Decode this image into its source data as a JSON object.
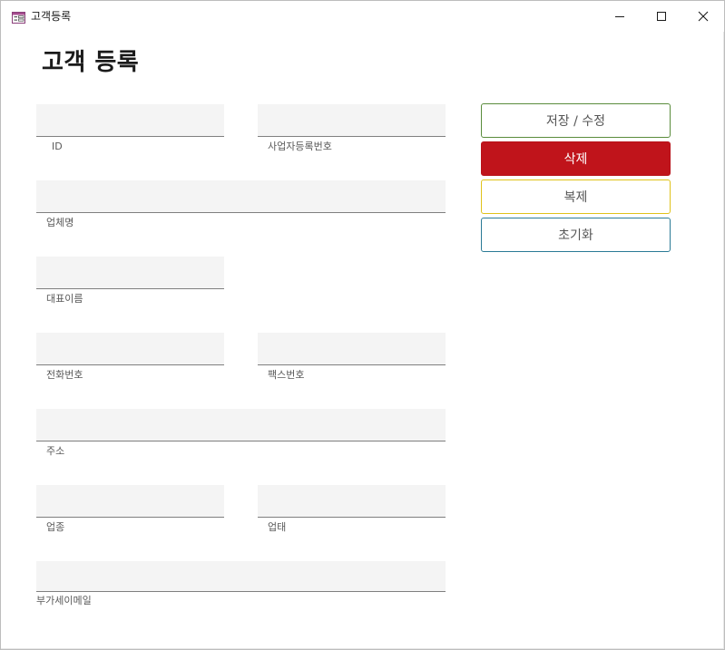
{
  "window": {
    "title": "고객등록",
    "controls": {
      "minimize": "minimize",
      "maximize": "maximize",
      "close": "close"
    }
  },
  "form": {
    "title": "고객 등록",
    "fields": {
      "id": {
        "label": "ID",
        "value": ""
      },
      "business_reg_no": {
        "label": "사업자등록번호",
        "value": ""
      },
      "company_name": {
        "label": "업체명",
        "value": ""
      },
      "representative": {
        "label": "대표이름",
        "value": ""
      },
      "phone": {
        "label": "전화번호",
        "value": ""
      },
      "fax": {
        "label": "팩스번호",
        "value": ""
      },
      "address": {
        "label": "주소",
        "value": ""
      },
      "business_type": {
        "label": "업종",
        "value": ""
      },
      "business_category": {
        "label": "업태",
        "value": ""
      },
      "vat_email": {
        "label": "부가세이메일",
        "value": ""
      }
    }
  },
  "actions": {
    "save": "저장 / 수정",
    "delete": "삭제",
    "copy": "복제",
    "reset": "초기화"
  },
  "colors": {
    "save_border": "#5a8c3c",
    "delete_fill": "#c0141b",
    "copy_border": "#e0c21a",
    "reset_border": "#2a7a95",
    "field_fill": "#f4f4f4"
  }
}
